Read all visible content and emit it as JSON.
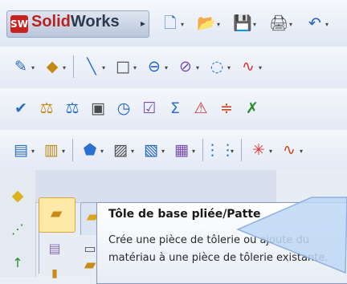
{
  "app": {
    "logo_text": "SW",
    "name_bold": "Solid",
    "name_rest": "Works",
    "menu_arrow": "▸"
  },
  "toolbar1": [
    {
      "name": "new-document-icon",
      "glyph": "🗋"
    },
    {
      "name": "open-folder-icon",
      "glyph": "📂"
    },
    {
      "name": "save-icon",
      "glyph": "💾"
    },
    {
      "name": "print-icon",
      "glyph": "🖨"
    },
    {
      "name": "undo-icon",
      "glyph": "↶"
    }
  ],
  "toolbar2": [
    {
      "name": "sketch-icon",
      "glyph": "✎"
    },
    {
      "name": "smart-dimension-icon",
      "glyph": "◆"
    },
    {
      "name": "line-icon",
      "glyph": "╲"
    },
    {
      "name": "rectangle-icon",
      "glyph": "□"
    },
    {
      "name": "slot-icon",
      "glyph": "⊖"
    },
    {
      "name": "circle-icon",
      "glyph": "⊘"
    },
    {
      "name": "arc-icon",
      "glyph": "◌"
    },
    {
      "name": "spline-icon",
      "glyph": "∿"
    }
  ],
  "toolbar3": [
    {
      "name": "spelling-icon",
      "glyph": "✔"
    },
    {
      "name": "measure-icon",
      "glyph": "⚖"
    },
    {
      "name": "mass-properties-icon",
      "glyph": "⚖"
    },
    {
      "name": "section-view-icon",
      "glyph": "▣"
    },
    {
      "name": "speedpak-icon",
      "glyph": "◷"
    },
    {
      "name": "check-icon",
      "glyph": "☑"
    },
    {
      "name": "sum-icon",
      "glyph": "Σ"
    },
    {
      "name": "analysis-icon",
      "glyph": "⚠"
    },
    {
      "name": "symmetry-icon",
      "glyph": "≑"
    },
    {
      "name": "equation-icon",
      "glyph": "✗"
    }
  ],
  "toolbar4": [
    {
      "name": "base-flange-icon",
      "glyph": "▤"
    },
    {
      "name": "flange-icon",
      "glyph": "▥"
    },
    {
      "name": "edge-flange-icon",
      "glyph": "⬟"
    },
    {
      "name": "miter-flange-icon",
      "glyph": "▨"
    },
    {
      "name": "hem-icon",
      "glyph": "▧"
    },
    {
      "name": "jog-icon",
      "glyph": "▦"
    },
    {
      "name": "pattern-icon",
      "glyph": "⋮⋮"
    },
    {
      "name": "reference-point-icon",
      "glyph": "✳"
    },
    {
      "name": "curve-icon",
      "glyph": "∿"
    }
  ],
  "tooltip": {
    "title": "Tôle de base pliée/Patte",
    "body": "Crée une pièce de tôlerie ou ajoute du matériau à une pièce de tôlerie existante."
  },
  "colors": {
    "toolbar_bg": "#e3e9f5",
    "accent_blue": "#1f7bd6",
    "brand_red": "#c8211e",
    "tooltip_border": "#8796b6"
  }
}
